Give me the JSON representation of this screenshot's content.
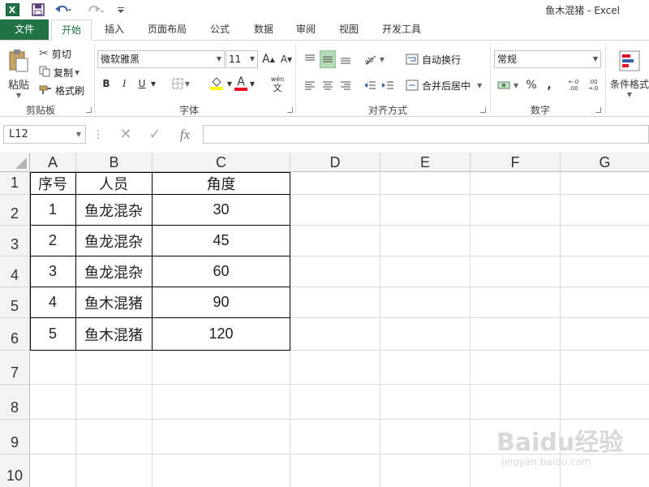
{
  "titlebar": {
    "title": "鱼木混猪 - Excel",
    "app_logo_letter": "X",
    "icons": [
      "excel-logo-icon",
      "save-icon",
      "undo-icon",
      "redo-icon",
      "customize-qat-icon"
    ]
  },
  "tabs": [
    {
      "label": "文件"
    },
    {
      "label": "开始"
    },
    {
      "label": "插入"
    },
    {
      "label": "页面布局"
    },
    {
      "label": "公式"
    },
    {
      "label": "数据"
    },
    {
      "label": "审阅"
    },
    {
      "label": "视图"
    },
    {
      "label": "开发工具"
    }
  ],
  "ribbon": {
    "clipboard": {
      "paste": "粘贴",
      "cut": "剪切",
      "copy": "复制",
      "format_painter": "格式刷",
      "group": "剪贴板"
    },
    "font": {
      "font_name": "微软雅黑",
      "font_size": "11",
      "grow": "A",
      "shrink": "A",
      "bold": "B",
      "italic": "I",
      "underline": "U",
      "font_color": "A",
      "wen": "wén",
      "wen_char": "文",
      "group": "字体"
    },
    "alignment": {
      "wrap_text": "自动换行",
      "merge_center": "合并后居中",
      "group": "对齐方式"
    },
    "number": {
      "format": "常规",
      "percent": "%",
      "comma": ",",
      "inc_decimal": "←.0 .00",
      "dec_decimal": ".00 →.0",
      "group": "数字"
    },
    "styles": {
      "conditional": "条件格式"
    }
  },
  "formula_bar": {
    "name_box": "L12",
    "cancel": "✕",
    "enter": "✓",
    "fx": "fx",
    "content": ""
  },
  "sheet": {
    "columns": [
      "A",
      "B",
      "C",
      "D",
      "E",
      "F",
      "G"
    ],
    "rows": [
      "1",
      "2",
      "3",
      "4",
      "5",
      "6",
      "7",
      "8",
      "9",
      "10"
    ],
    "headers": [
      "序号",
      "人员",
      "角度"
    ],
    "data": [
      [
        "1",
        "鱼龙混杂",
        "30"
      ],
      [
        "2",
        "鱼龙混杂",
        "45"
      ],
      [
        "3",
        "鱼龙混杂",
        "60"
      ],
      [
        "4",
        "鱼木混猪",
        "90"
      ],
      [
        "5",
        "鱼木混猪",
        "120"
      ]
    ]
  },
  "watermark": {
    "logo": "Baidu经验",
    "url": "jingyan.baidu.com"
  },
  "colors": {
    "excel_green": "#217346",
    "highlight_yellow": "#ffff00",
    "font_red": "#e81123"
  }
}
